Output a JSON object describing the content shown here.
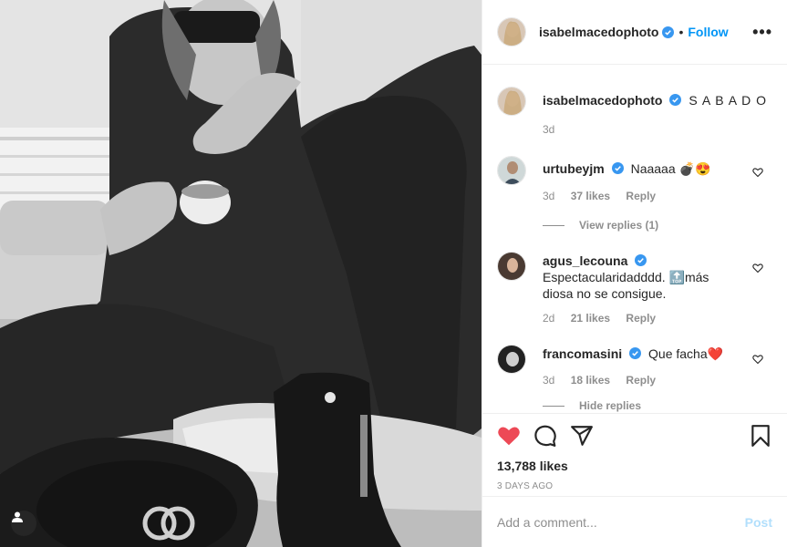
{
  "post": {
    "author": "isabelmacedophoto",
    "follow_label": "Follow",
    "separator": "•",
    "more_label": "•••",
    "caption": "S A B A D O",
    "caption_time": "3d"
  },
  "comments": [
    {
      "user": "urtubeyjm",
      "text": "Naaaaa 💣😍",
      "time": "3d",
      "likes": "37 likes",
      "reply": "Reply",
      "view_replies": "View replies (1)"
    },
    {
      "user": "agus_lecouna",
      "text": "Espectacularidadddd. 🔝más diosa no se consigue.",
      "time": "2d",
      "likes": "21 likes",
      "reply": "Reply"
    },
    {
      "user": "francomasini",
      "text": "Que facha❤️",
      "time": "3d",
      "likes": "18 likes",
      "reply": "Reply",
      "partial": "Hide replies"
    }
  ],
  "stats": {
    "likes": "13,788 likes",
    "posted": "3 DAYS AGO"
  },
  "composer": {
    "placeholder": "Add a comment...",
    "post_label": "Post"
  },
  "icons": {
    "like": "heart-filled-icon",
    "comment": "comment-icon",
    "share": "share-icon",
    "save": "bookmark-icon",
    "tags": "user-tag-icon"
  },
  "colors": {
    "accent": "#0095f6",
    "like": "#ed4956",
    "post_disabled": "#b2dffc",
    "muted": "#8e8e8e",
    "text": "#262626"
  }
}
